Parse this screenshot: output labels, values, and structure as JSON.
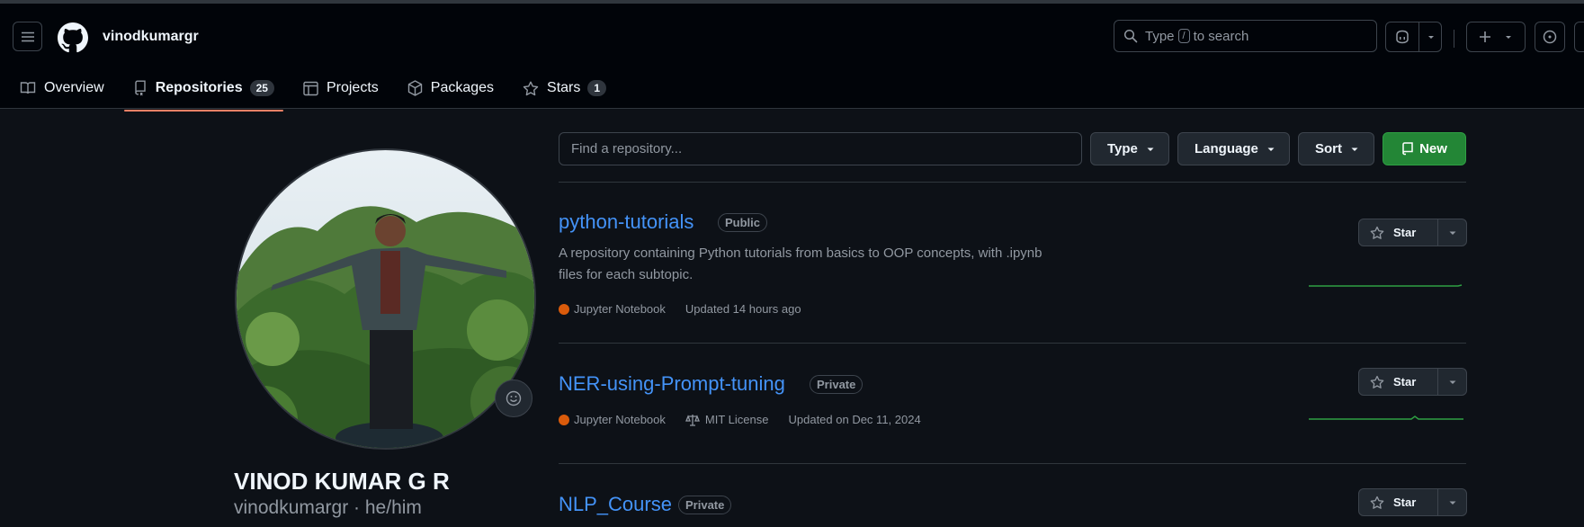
{
  "header": {
    "username": "vinodkumargr",
    "search": {
      "prefix": "Type",
      "key": "/",
      "suffix": "to search"
    }
  },
  "tabs": [
    {
      "label": "Overview"
    },
    {
      "label": "Repositories",
      "count": "25"
    },
    {
      "label": "Projects"
    },
    {
      "label": "Packages"
    },
    {
      "label": "Stars",
      "count": "1"
    }
  ],
  "profile": {
    "full_name": "VINOD KUMAR G R",
    "login_line": "vinodkumargr · he/him"
  },
  "toolbar": {
    "search_placeholder": "Find a repository...",
    "type_label": "Type",
    "language_label": "Language",
    "sort_label": "Sort",
    "new_label": "New"
  },
  "repos": [
    {
      "name": "python-tutorials",
      "visibility": "Public",
      "description": "A repository containing Python tutorials from basics to OOP concepts, with .ipynb files for each subtopic.",
      "language": "Jupyter Notebook",
      "language_color": "#DA5B0B",
      "updated": "Updated 14 hours ago",
      "star_label": "Star"
    },
    {
      "name": "NER-using-Prompt-tuning",
      "visibility": "Private",
      "language": "Jupyter Notebook",
      "language_color": "#DA5B0B",
      "license": "MIT License",
      "updated": "Updated on Dec 11, 2024",
      "star_label": "Star"
    },
    {
      "name": "NLP_Course",
      "visibility": "Private",
      "star_label": "Star"
    }
  ],
  "colors": {
    "accent_link": "#4493f8",
    "primary_button": "#238636",
    "tab_underline": "#f78166",
    "sparkline": "#2ea043"
  }
}
